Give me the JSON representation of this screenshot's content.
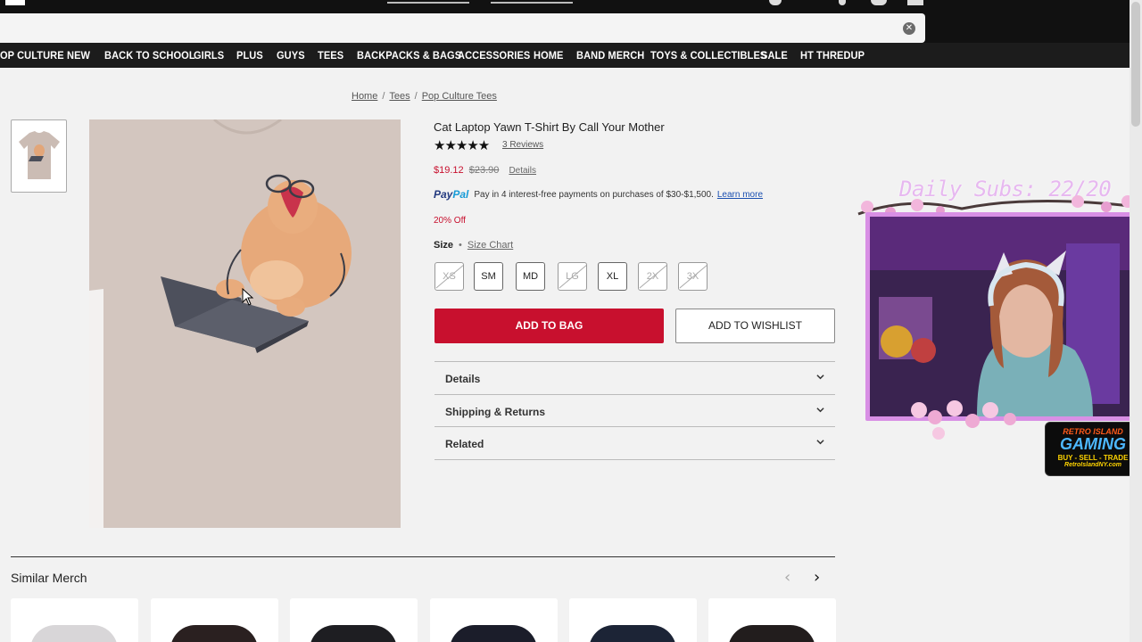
{
  "search": {
    "placeholder": "",
    "clear_icon": "close-icon"
  },
  "nav": {
    "items": [
      "OP CULTURE",
      "NEW",
      "BACK TO SCHOOL",
      "GIRLS",
      "PLUS",
      "GUYS",
      "TEES",
      "BACKPACKS & BAGS",
      "ACCESSORIES",
      "HOME",
      "BAND MERCH",
      "TOYS & COLLECTIBLES",
      "SALE",
      "HT THREDUP"
    ]
  },
  "breadcrumb": {
    "items": [
      "Home",
      "Tees",
      "Pop Culture Tees"
    ],
    "separator": "/"
  },
  "product": {
    "title": "Cat Laptop Yawn T-Shirt By Call Your Mother",
    "stars": "★★★★★",
    "rating": 5,
    "reviews": "3 Reviews",
    "sale_price": "$19.12",
    "original_price": "$23.90",
    "details_link": "Details",
    "paypal": {
      "logo_pay": "Pay",
      "logo_pal": "Pal",
      "text": "Pay in 4 interest-free payments on purchases of $30-$1,500.",
      "learn_more": "Learn more"
    },
    "discount": "20% Off",
    "size_label": "Size",
    "size_dot": "•",
    "size_chart": "Size Chart",
    "sizes": [
      {
        "label": "XS",
        "available": false
      },
      {
        "label": "SM",
        "available": true
      },
      {
        "label": "MD",
        "available": true
      },
      {
        "label": "LG",
        "available": false
      },
      {
        "label": "XL",
        "available": true
      },
      {
        "label": "2X",
        "available": false
      },
      {
        "label": "3X",
        "available": false
      }
    ],
    "add_to_bag": "ADD TO BAG",
    "add_to_wishlist": "ADD TO WISHLIST",
    "accordions": [
      "Details",
      "Shipping & Returns",
      "Related"
    ]
  },
  "similar": {
    "title": "Similar Merch",
    "prev": "‹",
    "next": "›"
  },
  "stream_overlay": {
    "title": "Daily Subs: 22/20",
    "sponsor": {
      "line1": "RETRO ISLAND",
      "line2": "GAMING",
      "line3": "BUY - SELL - TRADE",
      "line4": "RetroIslandNY.com"
    }
  },
  "colors": {
    "brand_red": "#c8102e",
    "nav_bg": "#1c1c1c",
    "overlay_pink": "#d88fe5"
  }
}
